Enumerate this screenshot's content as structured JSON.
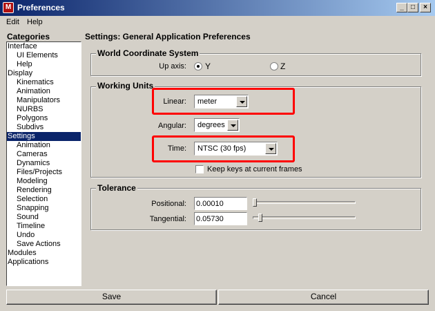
{
  "window": {
    "title": "Preferences",
    "min": "_",
    "max": "□",
    "close": "×"
  },
  "menu": [
    "Edit",
    "Help"
  ],
  "categories": {
    "label": "Categories",
    "items": [
      {
        "label": "Interface"
      },
      {
        "label": "UI Elements"
      },
      {
        "label": "Help"
      },
      {
        "label": "Display"
      },
      {
        "label": "Kinematics"
      },
      {
        "label": "Animation"
      },
      {
        "label": "Manipulators"
      },
      {
        "label": "NURBS"
      },
      {
        "label": "Polygons"
      },
      {
        "label": "Subdivs"
      },
      {
        "label": "Settings"
      },
      {
        "label": "Animation"
      },
      {
        "label": "Cameras"
      },
      {
        "label": "Dynamics"
      },
      {
        "label": "Files/Projects"
      },
      {
        "label": "Modeling"
      },
      {
        "label": "Rendering"
      },
      {
        "label": "Selection"
      },
      {
        "label": "Snapping"
      },
      {
        "label": "Sound"
      },
      {
        "label": "Timeline"
      },
      {
        "label": "Undo"
      },
      {
        "label": "Save Actions"
      },
      {
        "label": "Modules"
      },
      {
        "label": "Applications"
      }
    ],
    "selected": "Settings"
  },
  "settings_title": "Settings: General Application Preferences",
  "world": {
    "title": "World Coordinate System",
    "up_axis_label": "Up axis:",
    "y_label": "Y",
    "z_label": "Z",
    "selected": "Y"
  },
  "units": {
    "title": "Working Units",
    "linear_label": "Linear:",
    "linear_value": "meter",
    "angular_label": "Angular:",
    "angular_value": "degrees",
    "time_label": "Time:",
    "time_value": "NTSC (30 fps)",
    "keep_keys_label": "Keep keys at current frames",
    "keep_keys_checked": false
  },
  "tolerance": {
    "title": "Tolerance",
    "positional_label": "Positional:",
    "positional_value": "0.00010",
    "tangential_label": "Tangential:",
    "tangential_value": "0.05730"
  },
  "buttons": {
    "save": "Save",
    "cancel": "Cancel"
  },
  "colors": {
    "highlight": "#ff0000",
    "selection": "#0a246a",
    "background": "#d4d0c8"
  }
}
